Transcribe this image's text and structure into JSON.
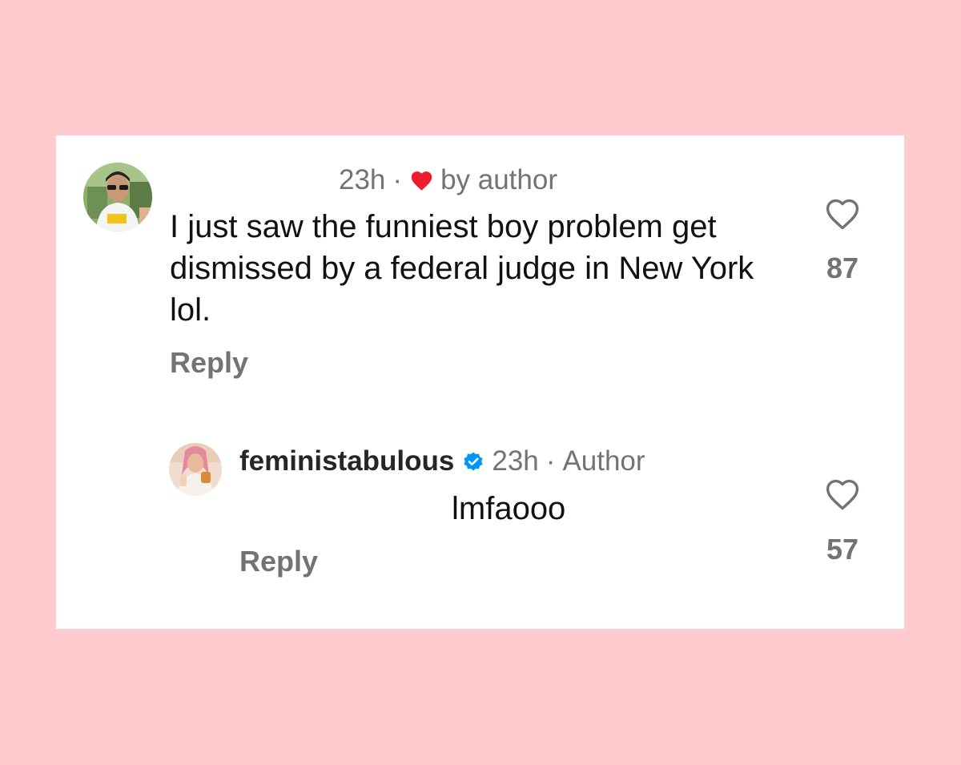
{
  "colors": {
    "page_background": "#fecbcf",
    "card_background": "#ffffff",
    "secondary_text": "#737373",
    "primary_text": "#111111",
    "heart_red": "#ed1c2e",
    "verified_blue": "#0095f6"
  },
  "comment": {
    "time": "23h",
    "separator": "·",
    "liked_by_label": "by author",
    "liked_icon": "heart-filled-icon",
    "text": "I just saw the funniest boy problem get dismissed by a federal judge in New York lol.",
    "reply_label": "Reply",
    "like_icon": "heart-outline-icon",
    "like_count": "87"
  },
  "reply": {
    "username": "feministabulous",
    "verified_icon": "verified-badge-icon",
    "time": "23h",
    "separator": "·",
    "role": "Author",
    "text": "lmfaooo",
    "reply_label": "Reply",
    "like_icon": "heart-outline-icon",
    "like_count": "57"
  }
}
